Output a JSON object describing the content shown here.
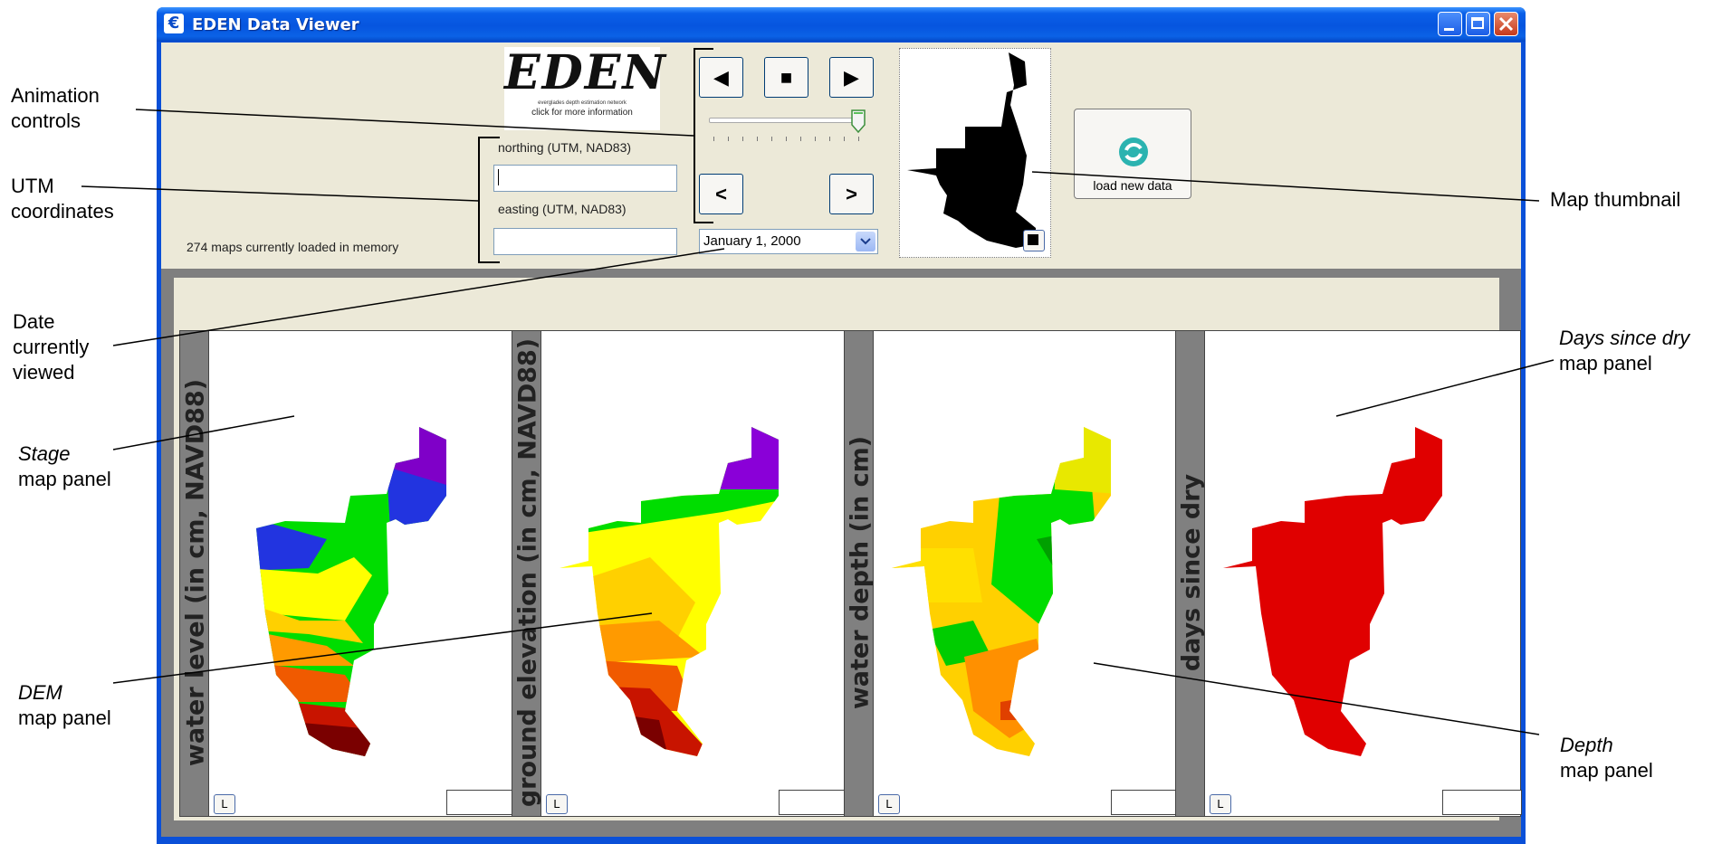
{
  "window": {
    "title": "EDEN Data Viewer",
    "app_icon_glyph": "€",
    "controls": [
      "minimize",
      "maximize",
      "close"
    ]
  },
  "logo": {
    "text": "EDEN",
    "subtitle": "everglades depth estimation network",
    "link": "click for more information"
  },
  "coordinates": {
    "northing_label": "northing (UTM, NAD83)",
    "northing_value": "",
    "easting_label": "easting (UTM, NAD83)",
    "easting_value": ""
  },
  "animation": {
    "back_icon": "◀",
    "stop_icon": "■",
    "play_icon": "▶",
    "prev_icon": "<",
    "next_icon": ">",
    "slider_position": 0.97
  },
  "date": {
    "selected": "January 1, 2000",
    "dropdown_icon": "chevron-down-icon"
  },
  "load_button": {
    "label": "load new data",
    "icon": "refresh-icon"
  },
  "status": {
    "text": "274 maps currently loaded in memory"
  },
  "panels": [
    {
      "title": "water level (in cm, NAVD88)",
      "legend_button": "L",
      "value": ""
    },
    {
      "title": "ground elevation (in cm, NAVD88)",
      "legend_button": "L",
      "value": ""
    },
    {
      "title": "water depth (in cm)",
      "legend_button": "L",
      "value": ""
    },
    {
      "title": "days since dry",
      "legend_button": "L",
      "value": ""
    }
  ],
  "annotations": {
    "animation_controls": [
      "Animation",
      "controls"
    ],
    "utm": [
      "UTM",
      "coordinates"
    ],
    "date": [
      "Date",
      "currently",
      "viewed"
    ],
    "stage": [
      "Stage",
      "map panel"
    ],
    "dem": [
      "DEM",
      "map panel"
    ],
    "thumbnail": "Map thumbnail",
    "days_since_dry": [
      "Days since dry",
      "map panel"
    ],
    "depth": [
      "Depth",
      "map panel"
    ]
  },
  "colors": {
    "titlebar": "#0a5fe8",
    "client": "#ece9d8",
    "panel_frame": "#7f7f7f",
    "days_dry_fill": "#e00000"
  }
}
